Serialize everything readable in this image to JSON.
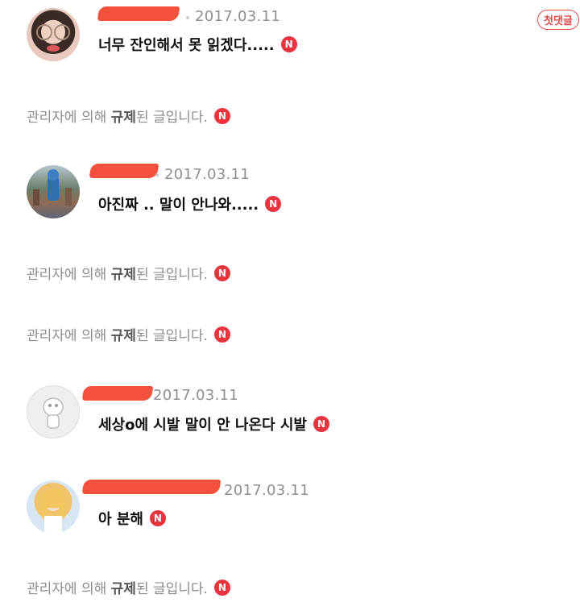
{
  "badge_letter": "N",
  "first_comment_badge": "첫댓글",
  "removed_text_parts": [
    "관리자에 의해 ",
    "규제",
    "된 글입니다."
  ],
  "comments": [
    {
      "date": "2017.03.11",
      "text": "너무 잔인해서 못 읽겠다....."
    },
    {
      "date": "2017.03.11",
      "text": "아진짜 .. 말이 안나와....."
    },
    {
      "date": "2017.03.11",
      "text": "세상o에 시발 말이 안 나온다 시발"
    },
    {
      "date": "2017.03.11",
      "text": "아 분해"
    }
  ],
  "colors": {
    "accent": "#e8343f",
    "redaction": "#f2513e",
    "muted": "#8d8d8d"
  }
}
